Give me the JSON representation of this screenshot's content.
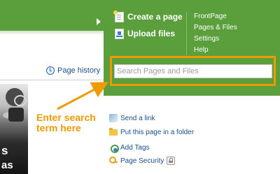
{
  "header": {
    "actions": {
      "create_page": "Create a page",
      "upload_files": "Upload files"
    },
    "nav": {
      "frontpage": "FrontPage",
      "pages_files": "Pages & Files",
      "settings": "Settings",
      "help": "Help"
    }
  },
  "search": {
    "placeholder": "Search Pages and Files",
    "value": ""
  },
  "page_panel": {
    "page_history": "Page history",
    "thumb_text": [
      "s",
      "as"
    ]
  },
  "annotation": {
    "lines": [
      "Enter search",
      "term here"
    ]
  },
  "page_actions": [
    {
      "label": "Send a link",
      "icon": "link-icon"
    },
    {
      "label": "Put this page in a folder",
      "icon": "folder-icon"
    },
    {
      "label": "Add Tags",
      "icon": "tag-icon"
    },
    {
      "label": "Page Security",
      "icon": "key-icon"
    }
  ],
  "colors": {
    "header_green": "#5a9f3c",
    "highlight_orange": "#ef9a00",
    "link_blue": "#1a4f8a"
  }
}
